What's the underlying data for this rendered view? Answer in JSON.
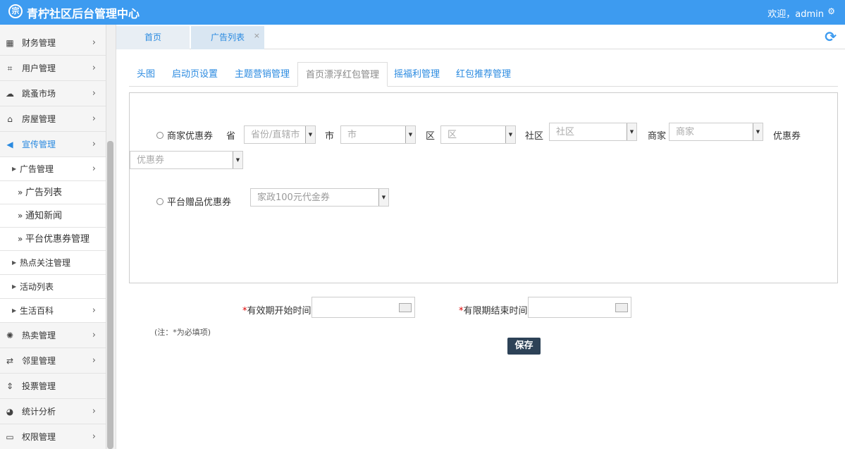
{
  "header": {
    "logo_glyph": "宗",
    "title": "青柠社区后台管理中心",
    "welcome": "欢迎，admin",
    "gear_icon": "gear-icon"
  },
  "sidebar": {
    "items": [
      {
        "label": "财务管理",
        "icon": "calculator-icon"
      },
      {
        "label": "用户管理",
        "icon": "crop-icon"
      },
      {
        "label": "跳蚤市场",
        "icon": "cloud-icon"
      },
      {
        "label": "房屋管理",
        "icon": "bank-icon"
      },
      {
        "label": "宣传管理",
        "icon": "megaphone-icon"
      }
    ],
    "subs": [
      {
        "label": "广告管理"
      },
      {
        "label": "热点关注管理"
      },
      {
        "label": "活动列表"
      },
      {
        "label": "生活百科"
      }
    ],
    "subsubs": [
      {
        "label": "广告列表"
      },
      {
        "label": "通知新闻"
      },
      {
        "label": "平台优惠券管理"
      }
    ],
    "items2": [
      {
        "label": "热卖管理"
      },
      {
        "label": "邻里管理"
      },
      {
        "label": "投票管理"
      },
      {
        "label": "统计分析"
      },
      {
        "label": "权限管理"
      }
    ]
  },
  "pagetabs": [
    {
      "label": "首页"
    },
    {
      "label": "广告列表"
    }
  ],
  "content_tabs": [
    {
      "label": "头图"
    },
    {
      "label": "启动页设置"
    },
    {
      "label": "主题营销管理"
    },
    {
      "label": "首页漂浮红包管理"
    },
    {
      "label": "摇福利管理"
    },
    {
      "label": "红包推荐管理"
    }
  ],
  "form": {
    "merchant_coupon_label": "商家优惠券",
    "province_label": "省",
    "province_placeholder": "省份/直辖市",
    "city_label": "市",
    "city_placeholder": "市",
    "district_label": "区",
    "district_placeholder": "区",
    "community_label": "社区",
    "community_placeholder": "社区",
    "merchant_label": "商家",
    "merchant_placeholder": "商家",
    "coupon_label": "优惠券",
    "coupon_placeholder": "优惠券",
    "platform_gift_label": "平台赠品优惠券",
    "platform_gift_value": "家政100元代金券",
    "start_label": "有效期开始时间",
    "end_label": "有限期结束时间",
    "required_mark": "*",
    "note": "(注：*为必填项)",
    "save_label": "保存"
  }
}
